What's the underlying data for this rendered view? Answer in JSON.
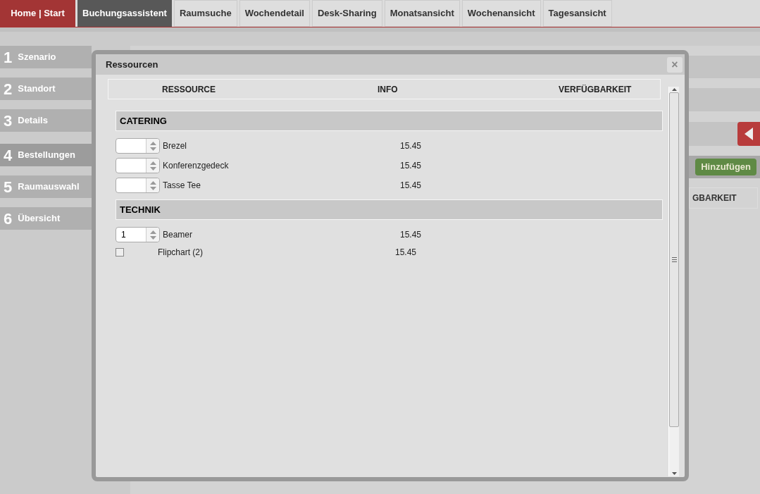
{
  "nav": {
    "home": "Home | Start",
    "tabs": [
      {
        "label": "Buchungsassistent",
        "selected": true
      },
      {
        "label": "Raumsuche",
        "selected": false
      },
      {
        "label": "Wochendetail",
        "selected": false
      },
      {
        "label": "Desk-Sharing",
        "selected": false
      },
      {
        "label": "Monatsansicht",
        "selected": false
      },
      {
        "label": "Wochenansicht",
        "selected": false
      },
      {
        "label": "Tagesansicht",
        "selected": false
      }
    ]
  },
  "steps": [
    {
      "number": "1",
      "label": "Szenario",
      "selected": false
    },
    {
      "number": "2",
      "label": "Standort",
      "selected": false
    },
    {
      "number": "3",
      "label": "Details",
      "selected": false
    },
    {
      "number": "4",
      "label": "Bestellungen",
      "selected": true
    },
    {
      "number": "5",
      "label": "Raumauswahl",
      "selected": false
    },
    {
      "number": "6",
      "label": "Übersicht",
      "selected": false
    }
  ],
  "main": {
    "add_button": "Hinzufügen",
    "column_header": "GBARKEIT"
  },
  "dialog": {
    "title": "Ressourcen",
    "close": "×",
    "columns": [
      "RESSOURCE",
      "INFO",
      "VERFÜGBARKEIT"
    ],
    "groups": [
      {
        "title": "CATERING",
        "items": [
          {
            "kind": "spinner",
            "name": "Brezel",
            "info": "15.45"
          },
          {
            "kind": "spinner",
            "name": "Konferenzgedeck",
            "info": "15.45"
          },
          {
            "kind": "spinner",
            "name": "Tasse Tee",
            "info": "15.45"
          }
        ]
      },
      {
        "title": "TECHNIK",
        "items": [
          {
            "kind": "spinner",
            "name": "Beamer",
            "info": "15.45",
            "value": "1"
          },
          {
            "kind": "checkbox",
            "name": "Flipchart (2)",
            "info": "15.45",
            "checked": false
          }
        ]
      }
    ]
  }
}
